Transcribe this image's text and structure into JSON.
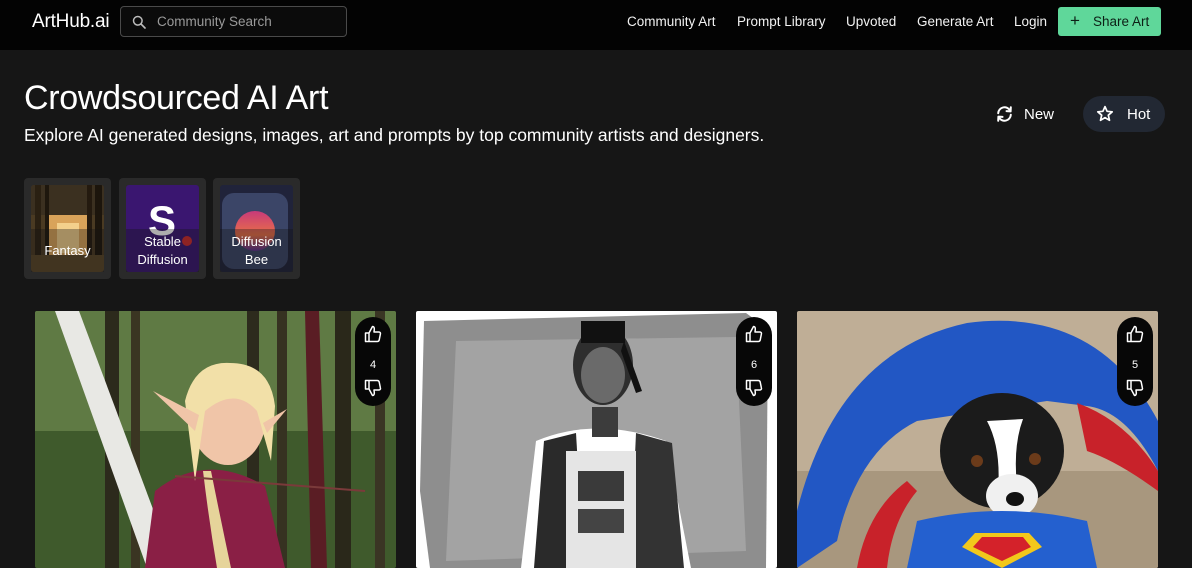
{
  "nav": {
    "logo": "ArtHub.ai",
    "search_placeholder": "Community Search",
    "links": [
      "Community Art",
      "Prompt Library",
      "Upvoted",
      "Generate Art",
      "Login"
    ],
    "share_label": "Share Art",
    "share_color": "#5fd79a"
  },
  "header": {
    "title": "Crowdsourced AI Art",
    "subtitle": "Explore AI generated designs, images, art and prompts by top community artists and designers."
  },
  "sort": {
    "new_label": "New",
    "hot_label": "Hot",
    "active": "Hot"
  },
  "categories": [
    {
      "label_lines": [
        "Fantasy"
      ],
      "thumb": "forest-icon"
    },
    {
      "label_lines": [
        "Stable",
        "Diffusion"
      ],
      "thumb": "s-logo-icon"
    },
    {
      "label_lines": [
        "Diffusion",
        "Bee"
      ],
      "thumb": "bee-sphere-icon"
    }
  ],
  "cards": [
    {
      "image": "elf-archer-image",
      "votes": "4"
    },
    {
      "image": "soldier-sketch-image",
      "votes": "6"
    },
    {
      "image": "superman-puppy-image",
      "votes": "5"
    }
  ]
}
